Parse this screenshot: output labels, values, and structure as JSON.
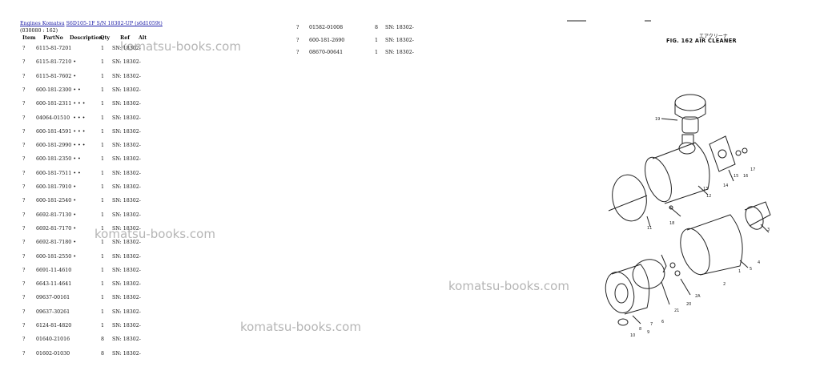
{
  "breadcrumb": {
    "items": [
      "Engines Komatsu",
      "S6D105-1F S/N 18302-UP (s6d1059t)"
    ],
    "separator": " "
  },
  "subtitle": "(030080 : 162)",
  "columns": [
    "Item",
    "PartNo",
    "Description",
    "Qty",
    "Ref",
    "Alt"
  ],
  "parts_left": [
    {
      "item": "?",
      "partno": "6115-81-7201",
      "qty": "1",
      "ref": "SN: 18302-"
    },
    {
      "item": "?",
      "partno": "6115-81-7210 •",
      "qty": "1",
      "ref": "SN: 18302-"
    },
    {
      "item": "?",
      "partno": "6115-81-7602 •",
      "qty": "1",
      "ref": "SN: 18302-"
    },
    {
      "item": "?",
      "partno": "600-181-2300 • •",
      "qty": "1",
      "ref": "SN: 18302-"
    },
    {
      "item": "?",
      "partno": "600-181-2311 • • •",
      "qty": "1",
      "ref": "SN: 18302-"
    },
    {
      "item": "?",
      "partno": "04064-01510  • • •",
      "qty": "1",
      "ref": "SN: 18302-"
    },
    {
      "item": "?",
      "partno": "600-181-4591 • • •",
      "qty": "1",
      "ref": "SN: 18302-"
    },
    {
      "item": "?",
      "partno": "600-181-2990 • • •",
      "qty": "1",
      "ref": "SN: 18302-"
    },
    {
      "item": "?",
      "partno": "600-181-2350 • •",
      "qty": "1",
      "ref": "SN: 18302-"
    },
    {
      "item": "?",
      "partno": "600-181-7511 • •",
      "qty": "1",
      "ref": "SN: 18302-"
    },
    {
      "item": "?",
      "partno": "600-181-7910 •",
      "qty": "1",
      "ref": "SN: 18302-"
    },
    {
      "item": "?",
      "partno": "600-181-2540 •",
      "qty": "1",
      "ref": "SN: 18302-"
    },
    {
      "item": "?",
      "partno": "6692-81-7130 •",
      "qty": "1",
      "ref": "SN: 18302-"
    },
    {
      "item": "?",
      "partno": "6692-81-7170 •",
      "qty": "1",
      "ref": "SN: 18302-"
    },
    {
      "item": "?",
      "partno": "6692-81-7180 •",
      "qty": "1",
      "ref": "SN: 18302-"
    },
    {
      "item": "?",
      "partno": "600-181-2550 •",
      "qty": "1",
      "ref": "SN: 18302-"
    },
    {
      "item": "?",
      "partno": "6691-11-4610",
      "qty": "1",
      "ref": "SN: 18302-"
    },
    {
      "item": "?",
      "partno": "6643-11-4641",
      "qty": "1",
      "ref": "SN: 18302-"
    },
    {
      "item": "?",
      "partno": "09637-00161",
      "qty": "1",
      "ref": "SN: 18302-"
    },
    {
      "item": "?",
      "partno": "09637-30261",
      "qty": "1",
      "ref": "SN: 18302-"
    },
    {
      "item": "?",
      "partno": "6124-81-4820",
      "qty": "1",
      "ref": "SN: 18302-"
    },
    {
      "item": "?",
      "partno": "01640-21016",
      "qty": "8",
      "ref": "SN: 18302-"
    },
    {
      "item": "?",
      "partno": "01602-01030",
      "qty": "8",
      "ref": "SN: 18302-"
    }
  ],
  "parts_right": [
    {
      "item": "?",
      "partno": "01582-01008",
      "qty": "8",
      "ref": "SN: 18302-"
    },
    {
      "item": "?",
      "partno": "600-181-2690",
      "qty": "1",
      "ref": "SN: 18302-"
    },
    {
      "item": "?",
      "partno": "08670-00641",
      "qty": "1",
      "ref": "SN: 18302-"
    }
  ],
  "watermarks": [
    "komatsu-books.com",
    "komatsu-books.com",
    "komatsu-books.com",
    "komatsu-books.com"
  ],
  "figure": {
    "title_jp": "エアクリーナ",
    "title": "FIG. 162 AIR CLEANER",
    "callouts": [
      "19",
      "16",
      "17",
      "15",
      "14",
      "13",
      "12",
      "11",
      "18",
      "3",
      "4",
      "5",
      "1",
      "2",
      "2A",
      "20",
      "21",
      "6",
      "7",
      "8",
      "9",
      "10"
    ]
  }
}
